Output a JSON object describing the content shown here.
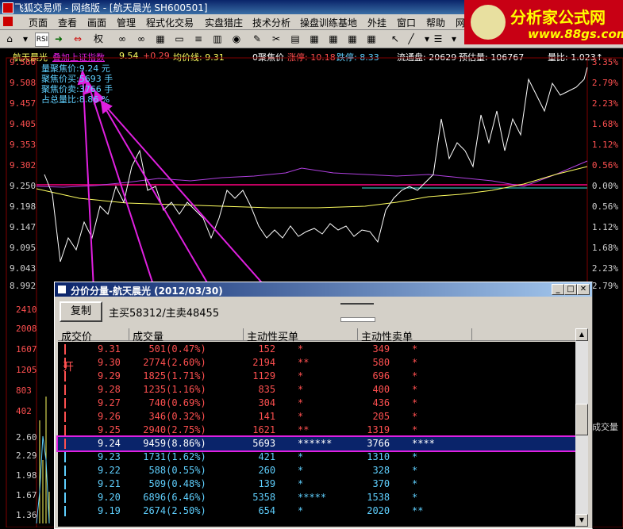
{
  "window": {
    "title": "飞狐交易师 - 网络版 - [航天晨光 SH600501]"
  },
  "menu": [
    "页面",
    "查看",
    "画面",
    "管理",
    "程式化交易",
    "实盘猎庄",
    "技术分析",
    "操盘训练基地",
    "外挂",
    "窗口",
    "帮助",
    "网"
  ],
  "logo": {
    "text": "分析家公式网",
    "url": "www.88gs.com"
  },
  "chart_header": {
    "name": "航天晨光",
    "overlay": "叠加上证指数",
    "price": "9.54",
    "change": "+0.29",
    "avg_label": "均价线: 9.31",
    "agg_label": "0聚焦价",
    "limit_up": "涨停: 10.18",
    "limit_down": "跌停: 8.33",
    "float": "流通盘: 20629",
    "est_vol": "预估量: 106767",
    "vol_ratio": "量比: 1.023↑"
  },
  "price_axis": [
    "9.560",
    "9.508",
    "9.457",
    "9.405",
    "9.353",
    "9.302",
    "9.250",
    "9.198",
    "9.147",
    "9.095",
    "9.043",
    "8.992"
  ],
  "pct_axis": [
    "3.35%",
    "2.79%",
    "2.23%",
    "1.68%",
    "1.12%",
    "0.56%",
    "0.00%",
    "0.56%",
    "1.12%",
    "1.68%",
    "2.23%",
    "2.79%"
  ],
  "vol_axis": [
    "2410",
    "2008",
    "1607",
    "1205",
    "803",
    "402"
  ],
  "low_axis": [
    "2.60",
    "2.29",
    "1.98",
    "1.67",
    "1.36"
  ],
  "right_label": "成交量",
  "info_box": {
    "line1": "量聚焦价:9.24 元",
    "line2": "聚焦价买:5693 手",
    "line3": "聚焦价卖:3766 手",
    "line4": "占总量比:8.86 %"
  },
  "dialog": {
    "title": "分价分量-航天晨光 (2012/03/30)",
    "copy_label": "复制",
    "buysell": "主买58312/主卖48455",
    "columns": [
      "成交价",
      "成交量",
      "主动性买单",
      "主动性卖单"
    ],
    "open_mark": "开",
    "rows": [
      {
        "price": "9.31",
        "vol": "  501(0.47%)",
        "buy": "  152",
        "bbar": "*",
        "sell": "  349",
        "sbar": "*",
        "color": "#ff5050"
      },
      {
        "price": "9.30",
        "vol": " 2774(2.60%)",
        "buy": " 2194",
        "bbar": "**",
        "sell": "  580",
        "sbar": "*",
        "color": "#ff5050"
      },
      {
        "price": "9.29",
        "vol": " 1825(1.71%)",
        "buy": " 1129",
        "bbar": "*",
        "sell": "  696",
        "sbar": "*",
        "color": "#ff5050"
      },
      {
        "price": "9.28",
        "vol": " 1235(1.16%)",
        "buy": "  835",
        "bbar": "*",
        "sell": "  400",
        "sbar": "*",
        "color": "#ff5050"
      },
      {
        "price": "9.27",
        "vol": "  740(0.69%)",
        "buy": "  304",
        "bbar": "*",
        "sell": "  436",
        "sbar": "*",
        "color": "#ff5050"
      },
      {
        "price": "9.26",
        "vol": "  346(0.32%)",
        "buy": "  141",
        "bbar": "*",
        "sell": "  205",
        "sbar": "*",
        "color": "#ff5050"
      },
      {
        "price": "9.25",
        "vol": " 2940(2.75%)",
        "buy": " 1621",
        "bbar": "**",
        "sell": " 1319",
        "sbar": "*",
        "color": "#ff5050"
      },
      {
        "price": "9.24",
        "vol": " 9459(8.86%)",
        "buy": " 5693",
        "bbar": "******",
        "sell": " 3766",
        "sbar": "****",
        "color": "#ffffff"
      },
      {
        "price": "9.23",
        "vol": " 1731(1.62%)",
        "buy": "  421",
        "bbar": "*",
        "sell": " 1310",
        "sbar": "*",
        "color": "#5fd0ff"
      },
      {
        "price": "9.22",
        "vol": "  588(0.55%)",
        "buy": "  260",
        "bbar": "*",
        "sell": "  328",
        "sbar": "*",
        "color": "#5fd0ff"
      },
      {
        "price": "9.21",
        "vol": "  509(0.48%)",
        "buy": "  139",
        "bbar": "*",
        "sell": "  370",
        "sbar": "*",
        "color": "#5fd0ff"
      },
      {
        "price": "9.20",
        "vol": " 6896(6.46%)",
        "buy": " 5358",
        "bbar": "*****",
        "sell": " 1538",
        "sbar": "*",
        "color": "#5fd0ff"
      },
      {
        "price": "9.19",
        "vol": " 2674(2.50%)",
        "buy": "  654",
        "bbar": "*",
        "sell": " 2020",
        "sbar": "**",
        "color": "#5fd0ff"
      }
    ]
  },
  "colors": {
    "up": "#ff5050",
    "down": "#5fd0ff",
    "highlight_row": "#0a246a",
    "annotation": "#e020e0"
  }
}
